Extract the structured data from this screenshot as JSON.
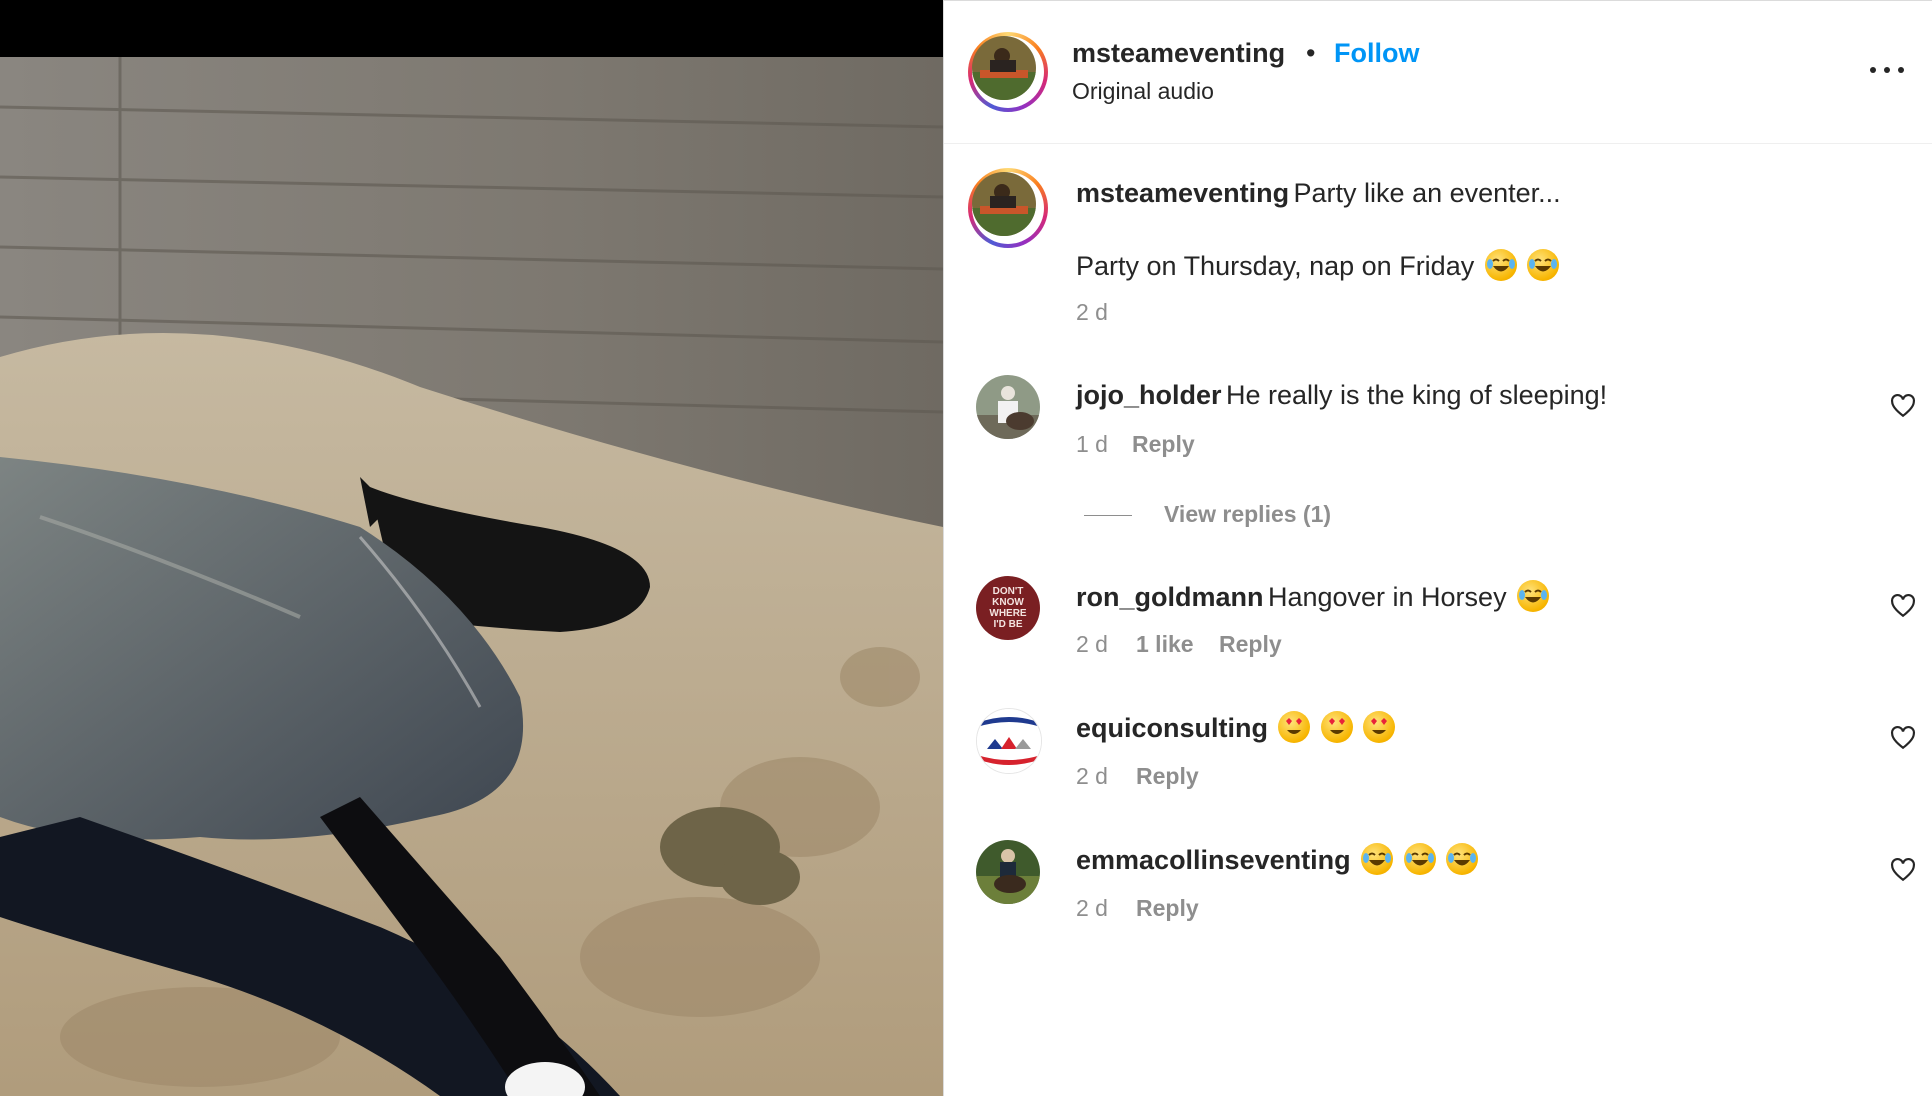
{
  "post": {
    "author": "msteameventing",
    "separator": "•",
    "follow_label": "Follow",
    "audio": "Original audio",
    "more_label": "More options",
    "caption_line1": "Party like an eventer...",
    "caption_line2": "Party on Thursday, nap on Friday",
    "caption_time": "2 d"
  },
  "comments": [
    {
      "user": "jojo_holder",
      "text": "He really is the king of sleeping!",
      "time": "1 d",
      "likes": "",
      "reply": "Reply",
      "view_replies": "View replies (1)"
    },
    {
      "user": "ron_goldmann",
      "text": "Hangover in Horsey",
      "time": "2 d",
      "likes": "1 like",
      "reply": "Reply"
    },
    {
      "user": "equiconsulting",
      "text": "",
      "time": "2 d",
      "likes": "",
      "reply": "Reply"
    },
    {
      "user": "emmacollinseventing",
      "text": "",
      "time": "2 d",
      "likes": "",
      "reply": "Reply"
    }
  ],
  "avatars": {
    "ron_goldmann_text": "DON'T KNOW WHERE I'D BE"
  },
  "icons": {
    "more": "more-horizontal-icon",
    "heart": "heart-outline-icon",
    "emoji_laugh": "face-with-tears-of-joy",
    "emoji_heart_eyes": "smiling-face-with-heart-eyes"
  },
  "colors": {
    "follow": "#0095f6",
    "meta": "#8e8e8e",
    "text": "#262626"
  }
}
